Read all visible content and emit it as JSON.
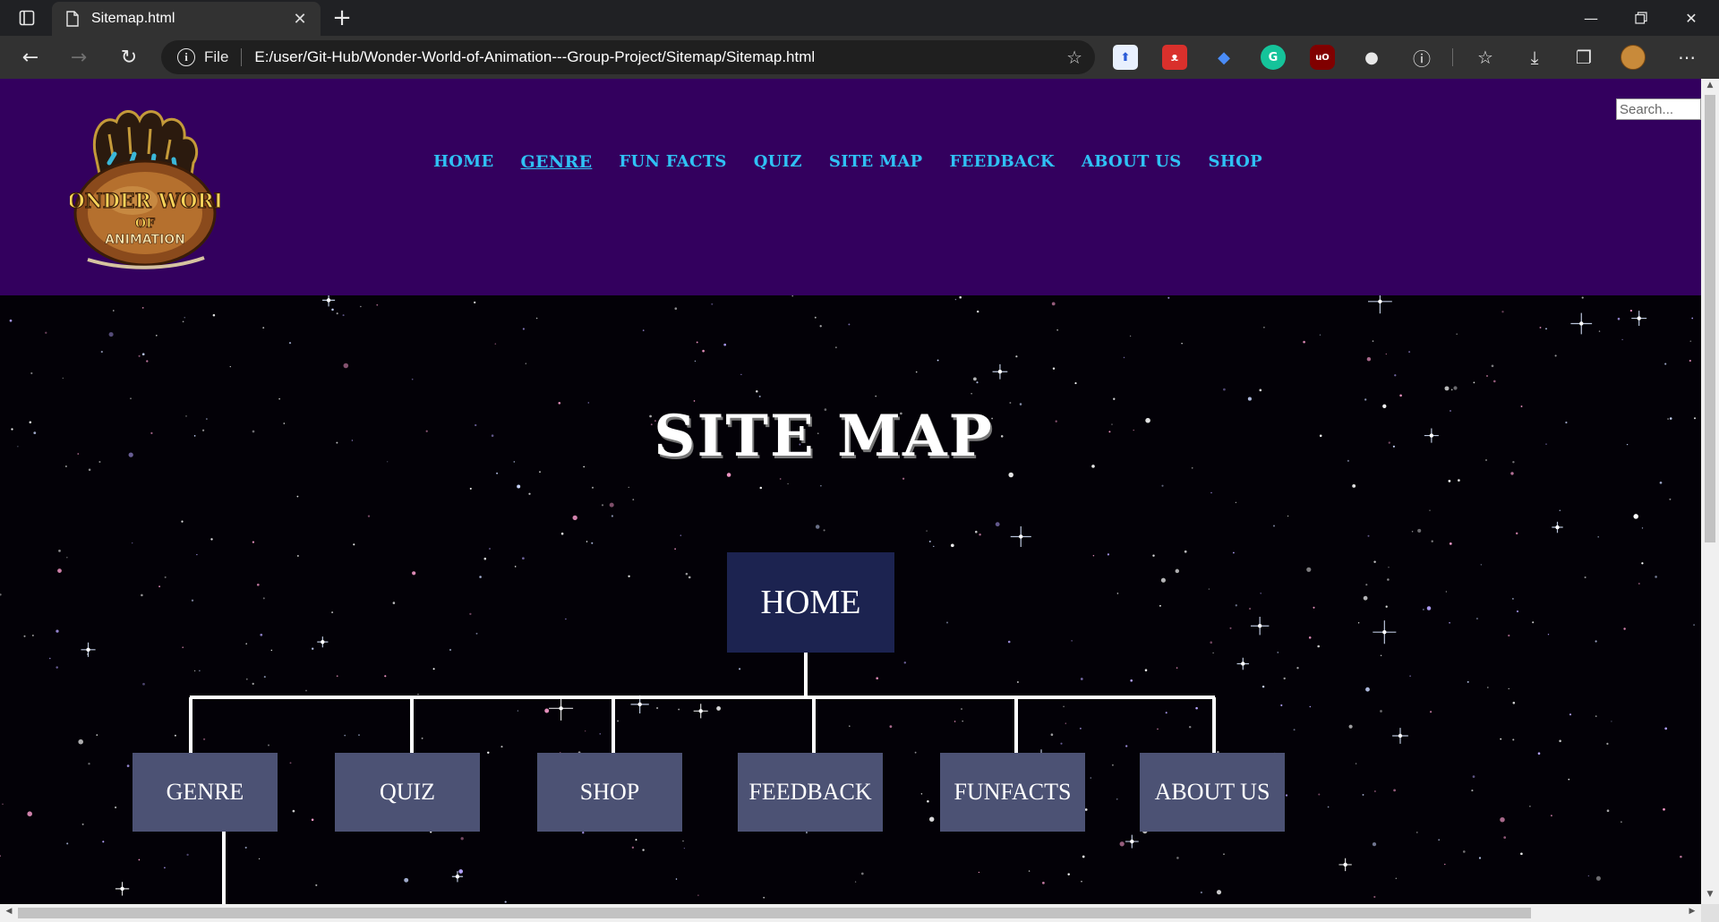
{
  "browser": {
    "tab_title": "Sitemap.html",
    "scheme_label": "File",
    "url": "E:/user/Git-Hub/Wonder-World-of-Animation---Group-Project/Sitemap/Sitemap.html",
    "extensions": [
      "upload-extension",
      "red-extension",
      "blue-extension",
      "grammarly-extension",
      "ublock-extension",
      "github-extension"
    ]
  },
  "site": {
    "logo_text": [
      "WONDER WORLD",
      "OF",
      "ANIMATION"
    ],
    "search_placeholder": "Search...",
    "nav": [
      "HOME",
      "GENRE",
      "FUN FACTS",
      "QUIZ",
      "SITE MAP",
      "FEEDBACK",
      "ABOUT US",
      "SHOP"
    ],
    "page_title": "SITE MAP"
  },
  "sitemap": {
    "root": "HOME",
    "children": [
      "GENRE",
      "QUIZ",
      "SHOP",
      "FEEDBACK",
      "FUNFACTS",
      "ABOUT US"
    ]
  },
  "colors": {
    "header_bg": "#33005e",
    "nav_link": "#2fc1f4",
    "root_node": "#1c2350",
    "child_node": "#4c5274"
  }
}
